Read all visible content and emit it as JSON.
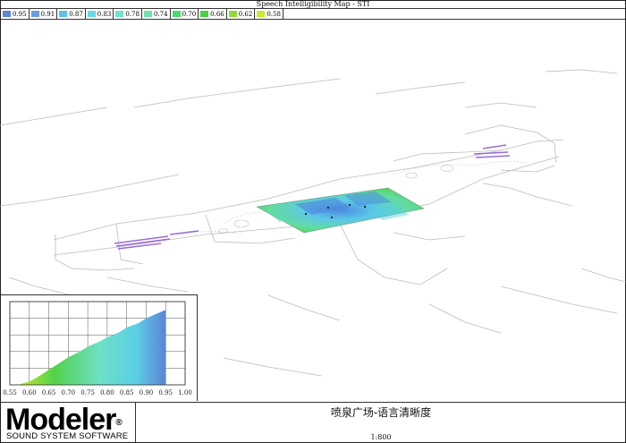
{
  "header": {
    "title": "Speech Intelligibility Map - STI"
  },
  "legend": {
    "items": [
      {
        "label": "0.95",
        "color": "#5b86d6"
      },
      {
        "label": "0.91",
        "color": "#6b9ae2"
      },
      {
        "label": "0.87",
        "color": "#5cc2e8"
      },
      {
        "label": "0.83",
        "color": "#66dbe4"
      },
      {
        "label": "0.78",
        "color": "#72e0cf"
      },
      {
        "label": "0.74",
        "color": "#6ee0ae"
      },
      {
        "label": "0.70",
        "color": "#4fd671"
      },
      {
        "label": "0.66",
        "color": "#49d246"
      },
      {
        "label": "0.62",
        "color": "#8ed93a"
      },
      {
        "label": "0.58",
        "color": "#cde82e"
      }
    ]
  },
  "chart_data": {
    "type": "area",
    "x": [
      0.57,
      0.6,
      0.62,
      0.65,
      0.68,
      0.7,
      0.73,
      0.75,
      0.78,
      0.8,
      0.83,
      0.85,
      0.88,
      0.9,
      0.93,
      0.95
    ],
    "y": [
      0,
      4,
      9,
      18,
      27,
      33,
      40,
      46,
      52,
      57,
      63,
      69,
      74,
      80,
      86,
      90
    ],
    "xticks": [
      "0.55",
      "0.60",
      "0.65",
      "0.70",
      "0.75",
      "0.80",
      "0.85",
      "0.90",
      "0.95",
      "1.00"
    ],
    "xlim": [
      0.55,
      1.0
    ],
    "ylim": [
      0,
      100
    ],
    "grid": true
  },
  "footer": {
    "logo_text": "Modeler",
    "logo_reg": "®",
    "logo_subtitle": "SOUND SYSTEM SOFTWARE",
    "project_title": "喷泉广场-语言清晰度",
    "scale": "1:800"
  }
}
